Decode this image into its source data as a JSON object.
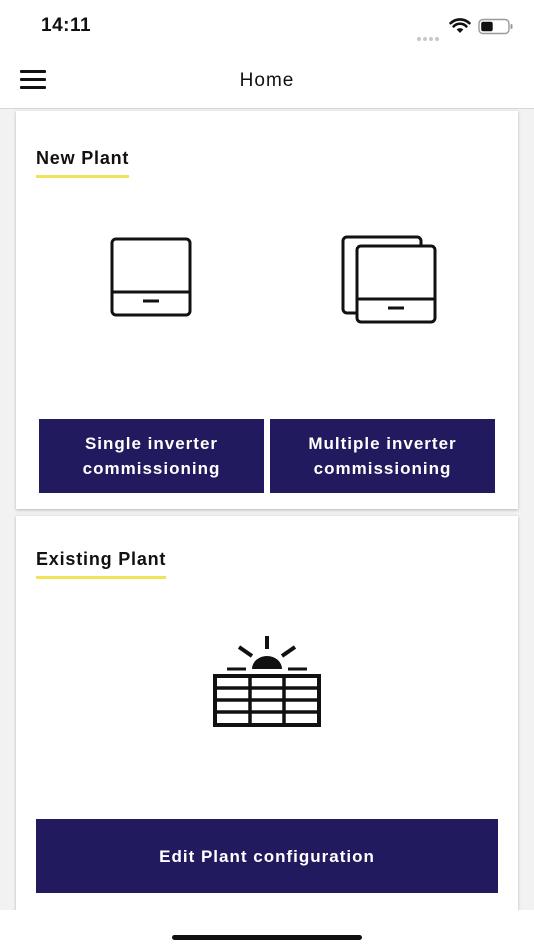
{
  "status_bar": {
    "time": "14:11",
    "signal_icon": "signal-dots-icon",
    "wifi_icon": "wifi-icon",
    "battery_icon": "battery-icon",
    "battery_level": 0.45
  },
  "nav": {
    "menu_icon": "hamburger-menu-icon",
    "title": "Home"
  },
  "new_plant": {
    "title": "New Plant",
    "single_icon": "single-inverter-icon",
    "multiple_icon": "multiple-inverter-icon",
    "single_button": "Single inverter commissioning",
    "multiple_button": "Multiple inverter commissioning"
  },
  "existing_plant": {
    "title": "Existing Plant",
    "icon": "solar-panel-icon",
    "edit_button": "Edit Plant configuration"
  },
  "colors": {
    "button_bg": "#221a5e",
    "title_underline": "#f0e35a",
    "page_bg": "#f2f2f2"
  }
}
